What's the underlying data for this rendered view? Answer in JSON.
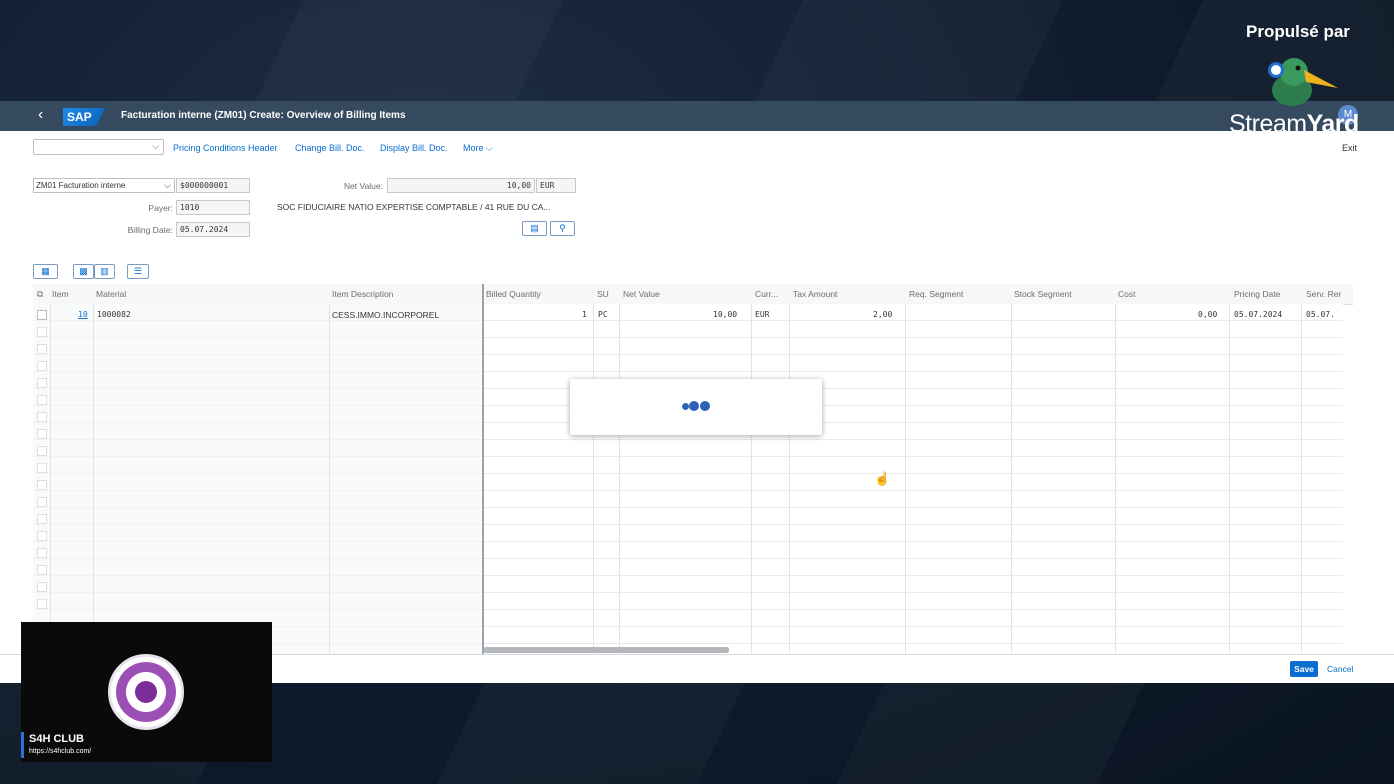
{
  "overlay": {
    "brand_text": "Propulsé par",
    "stream_light": "Stream",
    "stream_bold": "Yard",
    "avatar_initial": "M",
    "camera": {
      "name": "S4H CLUB",
      "url": "https://s4hclub.com/"
    }
  },
  "shell": {
    "back_label": "‹",
    "logo": "SAP",
    "title": "Facturation interne (ZM01) Create: Overview of Billing Items"
  },
  "toolbar": {
    "select_value": "",
    "links": [
      "Pricing Conditions Header",
      "Change Bill. Doc.",
      "Display Bill. Doc.",
      "More"
    ],
    "exit": "Exit"
  },
  "header": {
    "doc_type": "ZM01 Facturation interne",
    "doc_number": "$000000001",
    "net_value_label": "Net Value:",
    "net_value": "10,00",
    "currency": "EUR",
    "payer_label": "Payer:",
    "payer": "1010",
    "payer_name": "SOC FIDUCIAIRE NATIO EXPERTISE COMPTABLE / 41 RUE DU CA...",
    "billing_date_label": "Billing Date:",
    "billing_date": "05.07.2024"
  },
  "table": {
    "columns": [
      "Item",
      "Material",
      "Item Description",
      "Billed Quantity",
      "SU",
      "Net Value",
      "Curr...",
      "Tax Amount",
      "Req. Segment",
      "Stock Segment",
      "Cost",
      "Pricing Date",
      "Serv. Rer"
    ],
    "rows": [
      {
        "item": "10",
        "material": "1000082",
        "description": "CESS.IMMO.INCORPOREL",
        "billed_qty": "1",
        "su": "PC",
        "net_value": "10,00",
        "curr": "EUR",
        "tax_amount": "2,00",
        "req_segment": "",
        "stock_segment": "",
        "cost": "0,00",
        "pricing_date": "05.07.2024",
        "serv_ren": "05.07."
      }
    ]
  },
  "footer": {
    "save": "Save",
    "cancel": "Cancel"
  },
  "colors": {
    "shell": "#354a5f",
    "accent": "#0a6ed1",
    "busy_dots": "#2c63b8"
  }
}
